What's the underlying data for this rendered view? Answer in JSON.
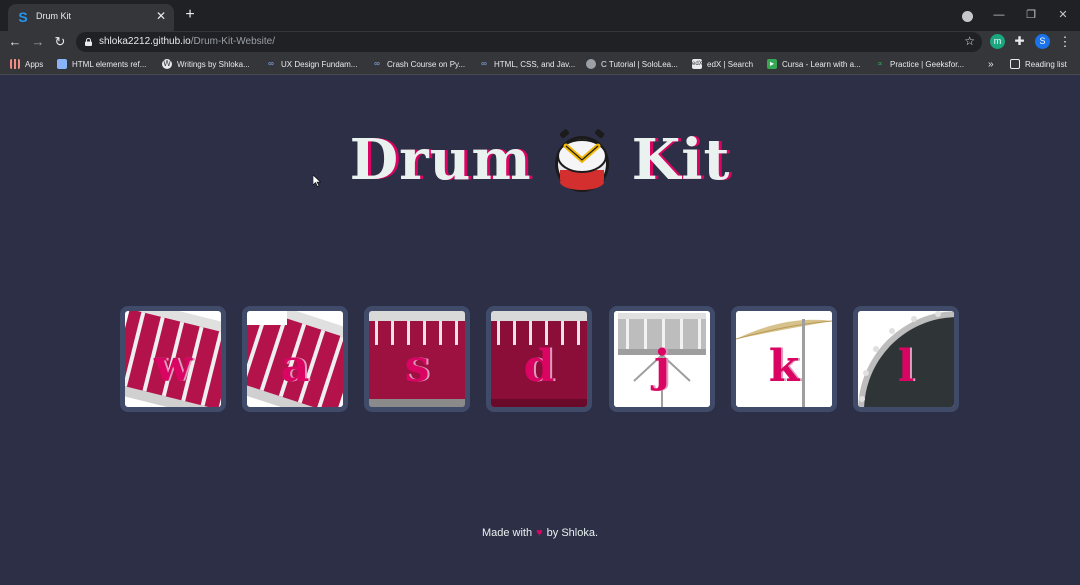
{
  "browser": {
    "tab_title": "Drum Kit",
    "favicon": "S",
    "close_glyph": "✕",
    "new_tab_glyph": "+",
    "url_host": "shloka2212.github.io",
    "url_path": "/Drum-Kit-Website/",
    "profile_initial": "S",
    "ext_initial": "m",
    "bookmarks": [
      {
        "label": "Apps"
      },
      {
        "label": "HTML elements ref..."
      },
      {
        "label": "Writings by Shloka..."
      },
      {
        "label": "UX Design Fundam..."
      },
      {
        "label": "Crash Course on Py..."
      },
      {
        "label": "HTML, CSS, and Jav..."
      },
      {
        "label": "C Tutorial | SoloLea..."
      },
      {
        "label": "edX | Search"
      },
      {
        "label": "Cursa - Learn with a..."
      },
      {
        "label": "Practice | Geeksfor..."
      }
    ],
    "more_bookmarks": "»",
    "reading_list": "Reading list"
  },
  "page": {
    "title_left": "Drum",
    "title_right": "Kit",
    "drums": [
      {
        "key": "w",
        "kind": "tom",
        "color": "#b3124a"
      },
      {
        "key": "a",
        "kind": "tom",
        "color": "#b3124a"
      },
      {
        "key": "s",
        "kind": "snare",
        "color": "#9c1140"
      },
      {
        "key": "d",
        "kind": "snare",
        "color": "#8a0e38"
      },
      {
        "key": "j",
        "kind": "snare-silver",
        "color": "#bdbdbd"
      },
      {
        "key": "k",
        "kind": "cymbal",
        "color": "#d8c28c"
      },
      {
        "key": "l",
        "kind": "bass",
        "color": "#2f3436"
      }
    ],
    "footer_before": "Made with",
    "footer_heart": "♥",
    "footer_after": "by Shloka."
  }
}
